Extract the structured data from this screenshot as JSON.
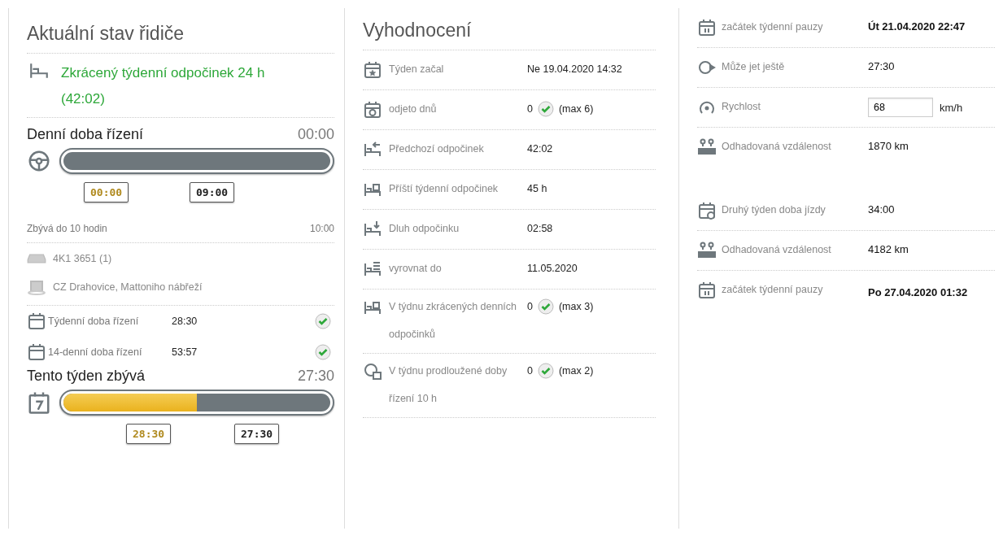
{
  "driver_status": {
    "title": "Aktuální stav řidiče",
    "status": "Zkrácený týdenní odpočinek 24 h (42:02)",
    "daily": {
      "label": "Denní doba řízení",
      "value": "00:00",
      "markers": [
        {
          "label": "00:00",
          "kind": "current"
        },
        {
          "label": "09:00",
          "kind": "limit"
        }
      ]
    },
    "remaining": {
      "label": "Zbývá do 10 hodin",
      "value": "10:00"
    },
    "vehicle": "4K1 3651 (1)",
    "location": "CZ Drahovice, Mattoniho nábřeží",
    "totals": [
      {
        "label": "Týdenní doba řízení",
        "value": "28:30",
        "ok": true
      },
      {
        "label": "14-denní doba řízení",
        "value": "53:57",
        "ok": true
      }
    ],
    "weekly": {
      "label": "Tento týden zbývá",
      "value": "27:30",
      "level": 0.5,
      "markers": [
        {
          "label": "28:30",
          "kind": "current"
        },
        {
          "label": "27:30",
          "kind": "limit"
        }
      ]
    }
  },
  "evaluation": {
    "title": "Vyhodnocení",
    "rows": [
      {
        "label": "Týden začal",
        "value": "Ne 19.04.2020 14:32"
      },
      {
        "label": "odjeto dnů",
        "value": "0",
        "ok": true,
        "note": "(max 6)"
      },
      {
        "label": "Předchozí odpočinek",
        "value": "42:02"
      },
      {
        "label": "Příští týdenní odpočinek",
        "value": "45 h"
      },
      {
        "label": "Dluh odpočinku",
        "value": "02:58"
      },
      {
        "label": "vyrovnat do",
        "value": "11.05.2020"
      },
      {
        "label": "V týdnu zkrácených denních odpočinků",
        "value": "0",
        "ok": true,
        "note": "(max 3)"
      },
      {
        "label": "V týdnu prodloužené doby řízení 10 h",
        "value": "0",
        "ok": true,
        "note": "(max 2)"
      }
    ]
  },
  "forecast": {
    "groups": [
      {
        "rows": [
          {
            "kind": "text",
            "label": "začátek týdenní pauzy",
            "value": "Út 21.04.2020 22:47"
          },
          {
            "kind": "text",
            "label": "Může jet ještě",
            "value": "27:30"
          },
          {
            "kind": "input",
            "label": "Rychlost",
            "value": "68",
            "unit": "km/h"
          },
          {
            "kind": "text",
            "label": "Odhadovaná vzdálenost",
            "value": "1870 km"
          }
        ]
      },
      {
        "rows": [
          {
            "kind": "text",
            "label": "Druhý týden doba jízdy",
            "value": "34:00"
          },
          {
            "kind": "text",
            "label": "Odhadovaná vzdálenost",
            "value": "4182 km"
          },
          {
            "kind": "text",
            "label": "začátek týdenní pauzy",
            "value": "Po 27.04.2020 01:32"
          }
        ]
      }
    ]
  }
}
